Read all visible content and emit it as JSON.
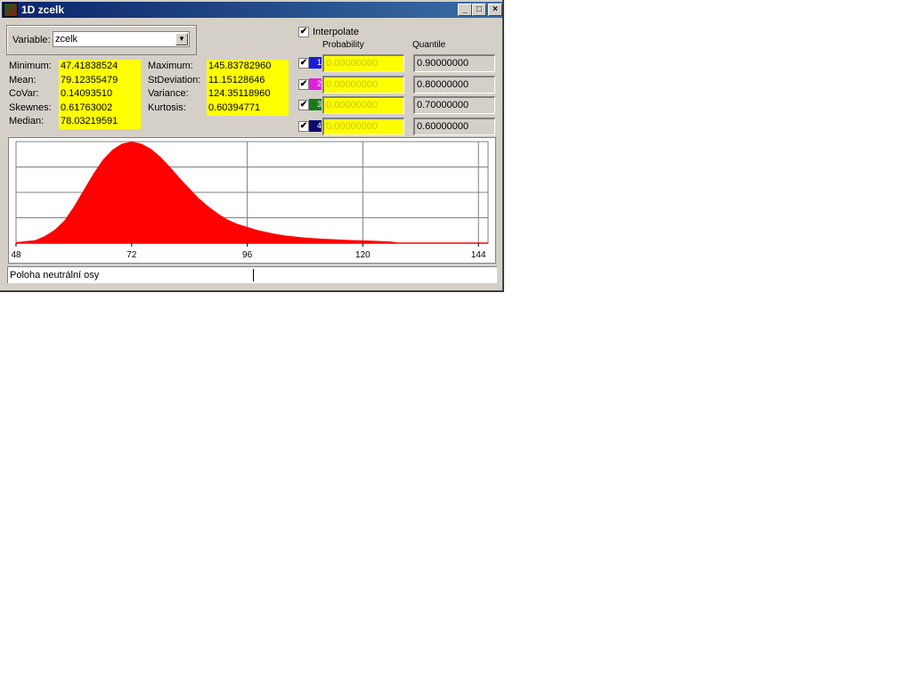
{
  "window": {
    "title": "1D zcelk"
  },
  "variable": {
    "label": "Variable:",
    "value": "zcelk"
  },
  "stats_left": [
    {
      "label": "Minimum:",
      "value": "47.41838524"
    },
    {
      "label": "Mean:",
      "value": "79.12355479"
    },
    {
      "label": "CoVar:",
      "value": "0.14093510"
    },
    {
      "label": "Skewnes:",
      "value": "0.61763002"
    },
    {
      "label": "Median:",
      "value": "78.03219591"
    }
  ],
  "stats_right": [
    {
      "label": "Maximum:",
      "value": "145.83782960"
    },
    {
      "label": "StDeviation:",
      "value": "11.15128646"
    },
    {
      "label": "Variance:",
      "value": "124.35118960"
    },
    {
      "label": "Kurtosis:",
      "value": "0.60394771"
    }
  ],
  "interpolate": {
    "label": "Interpolate",
    "checked": true
  },
  "quantiles": {
    "probability_header": "Probability",
    "quantile_header": "Quantile",
    "rows": [
      {
        "index": "1",
        "color": "#1c1cd8",
        "checked": true,
        "probability": "0.00000000",
        "quantile": "0.90000000"
      },
      {
        "index": "2",
        "color": "#e020e0",
        "checked": true,
        "probability": "0.00000000",
        "quantile": "0.80000000"
      },
      {
        "index": "3",
        "color": "#1a7a1a",
        "checked": true,
        "probability": "0.00000000",
        "quantile": "0.70000000"
      },
      {
        "index": "4",
        "color": "#0c0c70",
        "checked": true,
        "probability": "0.00000000",
        "quantile": "0.60000000"
      }
    ]
  },
  "chart_data": {
    "type": "area",
    "x": [
      48,
      50,
      52,
      54,
      56,
      58,
      60,
      62,
      64,
      66,
      68,
      70,
      72,
      74,
      76,
      78,
      80,
      82,
      84,
      86,
      88,
      90,
      92,
      94,
      96,
      98,
      100,
      102,
      104,
      106,
      108,
      110,
      112,
      114,
      116,
      118,
      120,
      122,
      124,
      126,
      128
    ],
    "values": [
      0.01,
      0.02,
      0.03,
      0.07,
      0.13,
      0.22,
      0.36,
      0.52,
      0.68,
      0.82,
      0.92,
      0.98,
      1.0,
      0.98,
      0.93,
      0.85,
      0.75,
      0.64,
      0.54,
      0.44,
      0.36,
      0.29,
      0.23,
      0.19,
      0.16,
      0.13,
      0.11,
      0.09,
      0.075,
      0.065,
      0.055,
      0.048,
      0.043,
      0.038,
      0.034,
      0.03,
      0.027,
      0.024,
      0.02,
      0.015,
      0.0
    ],
    "xticks": [
      48,
      72,
      96,
      120,
      144
    ],
    "xlim": [
      48,
      146
    ],
    "ylim": [
      0,
      1.0
    ],
    "grid": true,
    "color": "#ff0000"
  },
  "status": {
    "text": "Poloha neutrální osy"
  }
}
